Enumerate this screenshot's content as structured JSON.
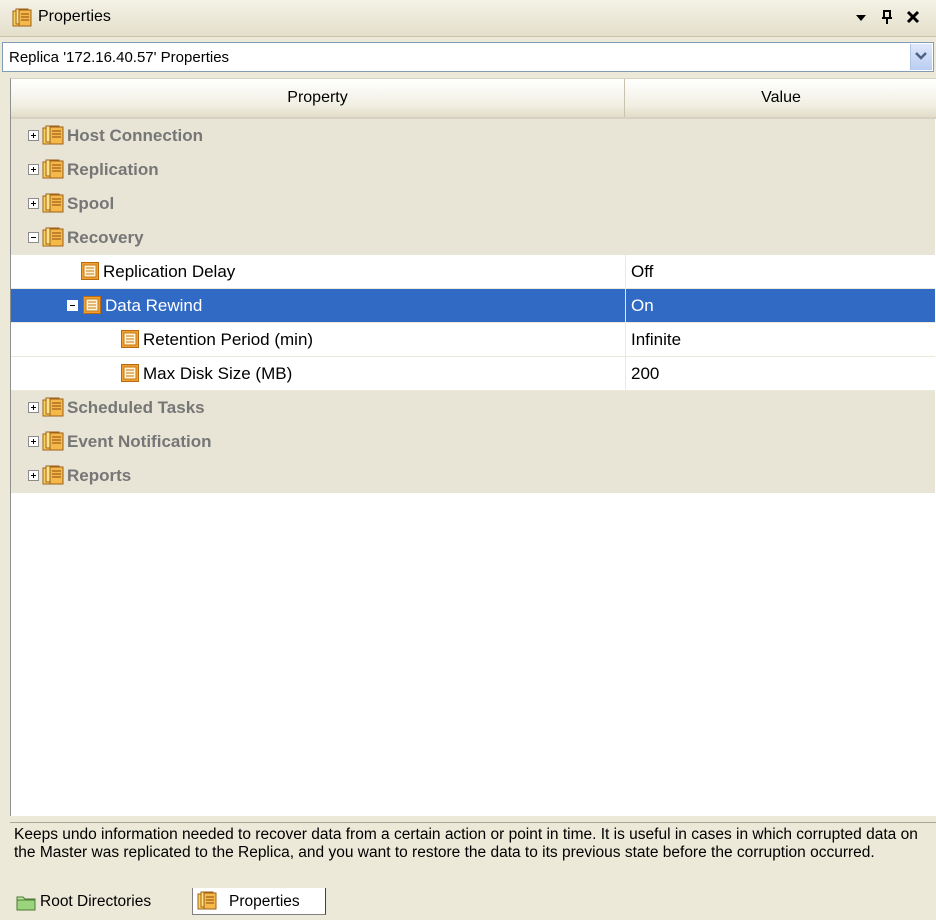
{
  "titlebar": {
    "title": "Properties",
    "icon": "properties-icon",
    "buttons": [
      {
        "name": "dropdown-arrow-icon",
        "glyph": "▼"
      },
      {
        "name": "pin-icon",
        "glyph": "ᛘ"
      },
      {
        "name": "close-icon",
        "glyph": "✕"
      }
    ]
  },
  "selector": {
    "value": "Replica '172.16.40.57' Properties"
  },
  "grid": {
    "columns": [
      "Property",
      "Value"
    ],
    "rows": [
      {
        "type": "category",
        "label": "Host Connection",
        "expanded": false,
        "level": 0
      },
      {
        "type": "category",
        "label": "Replication",
        "expanded": false,
        "level": 0
      },
      {
        "type": "category",
        "label": "Spool",
        "expanded": false,
        "level": 0
      },
      {
        "type": "category",
        "label": "Recovery",
        "expanded": true,
        "level": 0
      },
      {
        "type": "property",
        "label": "Replication Delay",
        "value": "Off",
        "level": 1
      },
      {
        "type": "property",
        "label": "Data Rewind",
        "value": "On",
        "level": 1,
        "expanded": true,
        "selected": true
      },
      {
        "type": "property",
        "label": "Retention Period (min)",
        "value": "Infinite",
        "level": 2
      },
      {
        "type": "property",
        "label": "Max Disk Size (MB)",
        "value": "200",
        "level": 2
      },
      {
        "type": "category",
        "label": "Scheduled Tasks",
        "expanded": false,
        "level": 0
      },
      {
        "type": "category",
        "label": "Event Notification",
        "expanded": false,
        "level": 0
      },
      {
        "type": "category",
        "label": "Reports",
        "expanded": false,
        "level": 0
      }
    ]
  },
  "description": "Keeps undo information needed to recover data from a certain action or point in time. It is useful in cases in which corrupted data on the Master was replicated to the Replica, and you want to restore the data to its previous state before the corruption occurred.",
  "tabs": [
    {
      "label": "Root Directories",
      "icon": "folder-icon",
      "active": false
    },
    {
      "label": "Properties",
      "icon": "properties-icon",
      "active": true
    }
  ],
  "colors": {
    "selection": "#316ac5",
    "category_bg": "#e8e5d7",
    "category_text": "#767676",
    "icon_orange": "#f0a030"
  }
}
